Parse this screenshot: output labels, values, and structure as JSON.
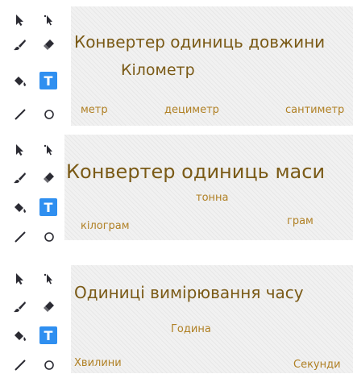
{
  "icons": [
    "select-arrow-icon",
    "reshape-icon",
    "brush-icon",
    "eraser-icon",
    "fill-icon",
    "text-tool-icon",
    "line-icon",
    "ellipse-icon"
  ],
  "colors": {
    "accent": "#2f8ff0",
    "text_dark": "#7a5a16",
    "text_light": "#b08024"
  },
  "panels": [
    {
      "title": "Конвертер одиниць довжини",
      "subtitle": "Кілометр",
      "words": [
        "метр",
        "дециметр",
        "сантиметр"
      ]
    },
    {
      "title": "Конвертер одиниць маси",
      "words": [
        "тонна",
        "кілограм",
        "грам"
      ]
    },
    {
      "title": "Одиниці вимірювання часу",
      "words": [
        "Година",
        "Хвилини",
        "Секунди"
      ]
    }
  ]
}
